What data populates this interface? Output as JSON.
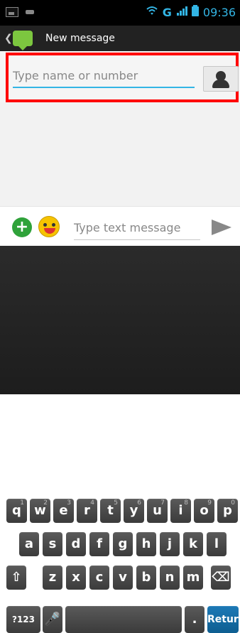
{
  "status_bar": {
    "network": "G",
    "time": "09:36"
  },
  "action_bar": {
    "title": "New message"
  },
  "recipient": {
    "placeholder": "Type name or number"
  },
  "compose": {
    "placeholder": "Type text message"
  },
  "keyboard": {
    "row1": [
      {
        "label": "q",
        "alt": "1"
      },
      {
        "label": "w",
        "alt": "2"
      },
      {
        "label": "e",
        "alt": "3"
      },
      {
        "label": "r",
        "alt": "4"
      },
      {
        "label": "t",
        "alt": "5"
      },
      {
        "label": "y",
        "alt": "6"
      },
      {
        "label": "u",
        "alt": "7"
      },
      {
        "label": "i",
        "alt": "8"
      },
      {
        "label": "o",
        "alt": "9"
      },
      {
        "label": "p",
        "alt": "0"
      }
    ],
    "row2": [
      "a",
      "s",
      "d",
      "f",
      "g",
      "h",
      "j",
      "k",
      "l"
    ],
    "row3": [
      "z",
      "x",
      "c",
      "v",
      "b",
      "n",
      "m"
    ],
    "row4": {
      "numbers": "?123",
      "dot": ".",
      "return": "Return"
    }
  },
  "colors": {
    "status_blue": "#33b5e5",
    "highlight_red": "#ff0000",
    "app_green": "#7cc63f"
  },
  "icons": {
    "contact": "person-icon",
    "add": "plus-icon",
    "emoji": "smiley-icon",
    "send": "send-icon"
  }
}
